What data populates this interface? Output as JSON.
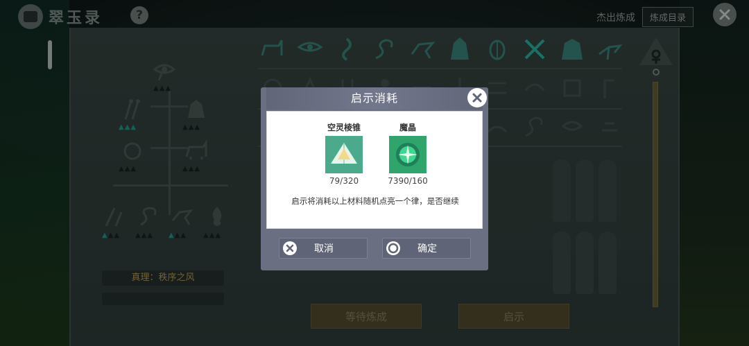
{
  "header": {
    "app_title": "翠玉录",
    "help_label": "?",
    "hero_label": "杰出炼成",
    "catalog_label": "炼成目录"
  },
  "truth": {
    "label": "真理：秩序之风"
  },
  "bottom_buttons": {
    "waiting_label": "等待炼成",
    "reveal_label": "启示"
  },
  "modal": {
    "title": "启示消耗",
    "items": [
      {
        "name": "空灵棱锥",
        "count": "79/320",
        "icon": "pyramid-icon"
      },
      {
        "name": "魔晶",
        "count": "7390/160",
        "icon": "crystal-orb-icon"
      }
    ],
    "description": "启示将消耗以上材料随机点亮一个律，是否继续",
    "cancel_label": "取消",
    "confirm_label": "确定"
  },
  "colors": {
    "modal_frame": "#6a6f82",
    "modal_button": "#5f6477",
    "teal_accent": "#2aa397",
    "gold_text": "#c7a75b"
  }
}
